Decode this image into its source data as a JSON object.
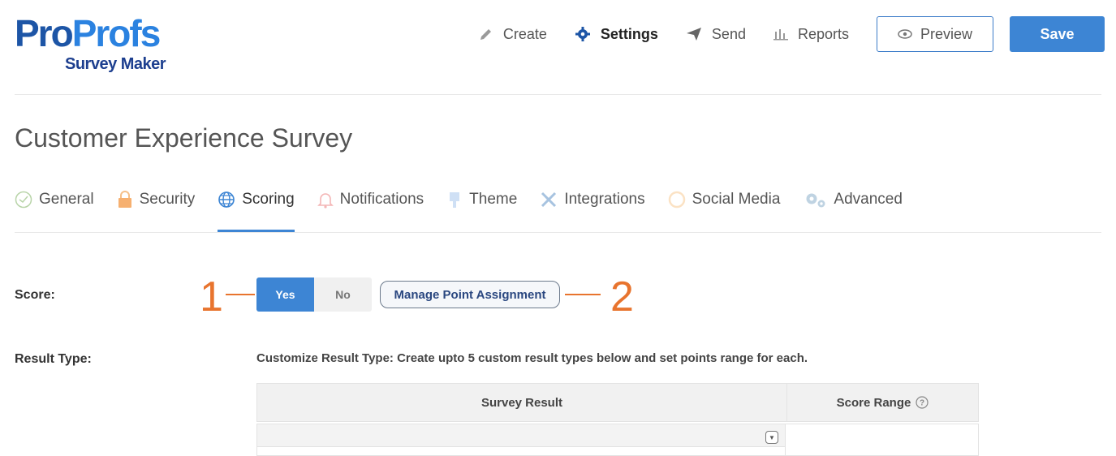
{
  "logo": {
    "part1": "Pro",
    "part2": "Profs",
    "subtitle": "Survey Maker"
  },
  "nav": {
    "create": "Create",
    "settings": "Settings",
    "send": "Send",
    "reports": "Reports",
    "preview": "Preview",
    "save": "Save"
  },
  "page": {
    "title": "Customer Experience Survey"
  },
  "tabs": [
    {
      "label": "General"
    },
    {
      "label": "Security"
    },
    {
      "label": "Scoring"
    },
    {
      "label": "Notifications"
    },
    {
      "label": "Theme"
    },
    {
      "label": "Integrations"
    },
    {
      "label": "Social Media"
    },
    {
      "label": "Advanced"
    }
  ],
  "active_tab": "Scoring",
  "score": {
    "label": "Score:",
    "yes": "Yes",
    "no": "No",
    "selected": "Yes",
    "manage_button": "Manage Point Assignment",
    "callout_1": "1",
    "callout_2": "2"
  },
  "result_type": {
    "label": "Result Type:",
    "note": "Customize Result Type:  Create upto 5 custom result types below and set points range for each.",
    "columns": [
      "Survey Result",
      "Score Range"
    ]
  },
  "colors": {
    "accent": "#3d85d4",
    "callout": "#e8742e",
    "brand": "#1d55a6"
  }
}
